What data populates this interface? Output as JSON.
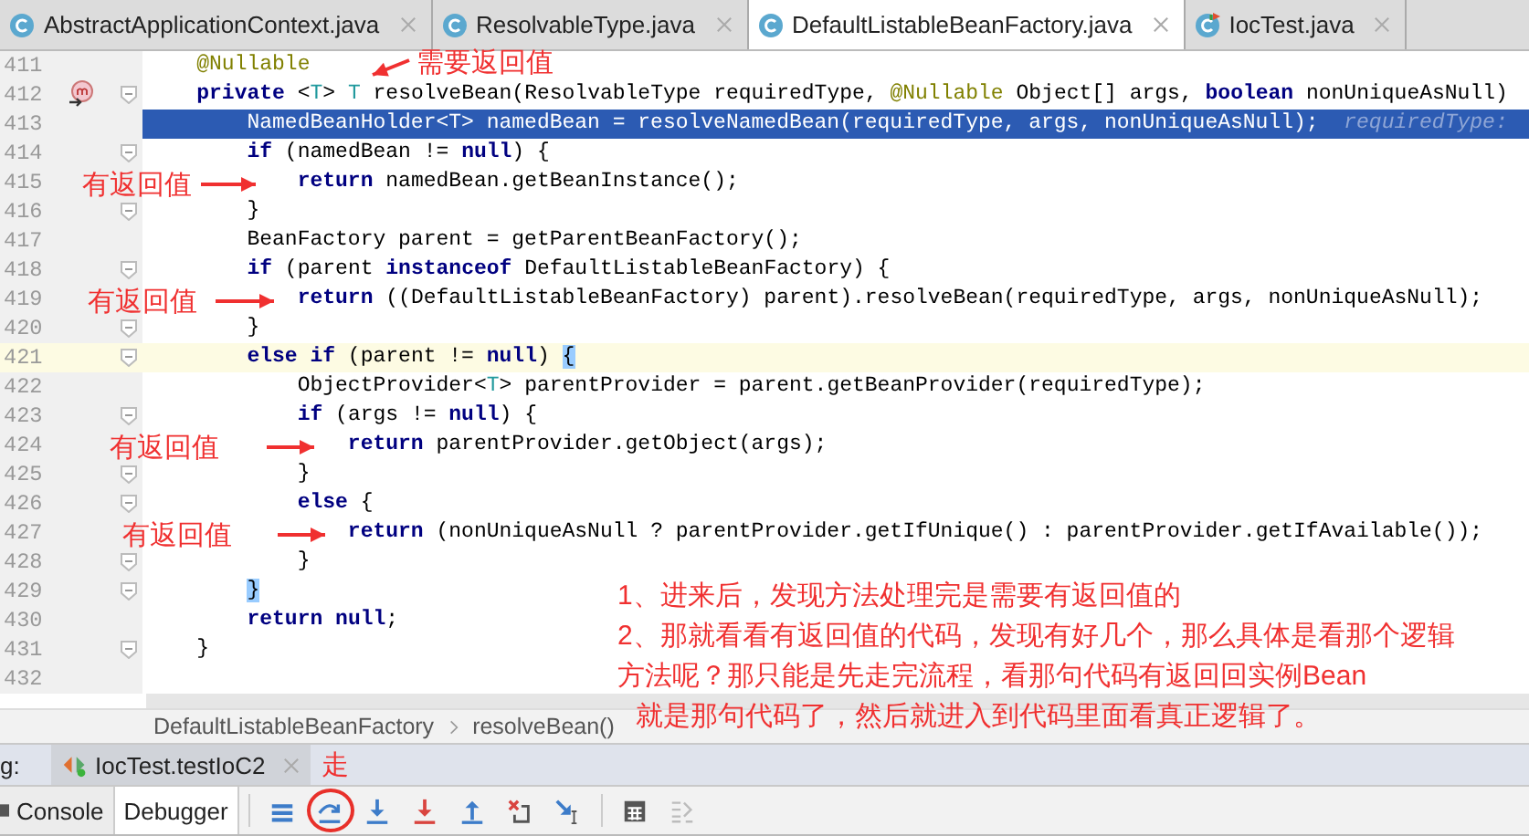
{
  "editor_tabs": [
    {
      "label": "AbstractApplicationContext.java",
      "selected": false,
      "kind": "class"
    },
    {
      "label": "ResolvableType.java",
      "selected": false,
      "kind": "class"
    },
    {
      "label": "DefaultListableBeanFactory.java",
      "selected": true,
      "kind": "class"
    },
    {
      "label": "IocTest.java",
      "selected": false,
      "kind": "test"
    }
  ],
  "code_lines": [
    {
      "number": "411",
      "fold": false,
      "execution": false,
      "caret": false,
      "method_marker": false,
      "segments": [
        {
          "text": "    @Nullable",
          "kind": "annotation"
        }
      ]
    },
    {
      "number": "412",
      "fold": true,
      "execution": false,
      "caret": false,
      "method_marker": true,
      "segments": [
        {
          "text": "    private",
          "kind": "keyword"
        },
        {
          "text": " <",
          "kind": "plain"
        },
        {
          "text": "T",
          "kind": "type_param"
        },
        {
          "text": "> ",
          "kind": "plain"
        },
        {
          "text": "T",
          "kind": "type_param"
        },
        {
          "text": " resolveBean(ResolvableType requiredType, ",
          "kind": "plain"
        },
        {
          "text": "@Nullable",
          "kind": "annotation"
        },
        {
          "text": " Object[] args, ",
          "kind": "plain"
        },
        {
          "text": "boolean",
          "kind": "keyword"
        },
        {
          "text": " nonUniqueAsNull)",
          "kind": "plain"
        }
      ]
    },
    {
      "number": "413",
      "fold": false,
      "execution": true,
      "caret": false,
      "method_marker": false,
      "segments": [
        {
          "text": "        NamedBeanHolder<T> namedBean = resolveNamedBean(requiredType, args, nonUniqueAsNull);  ",
          "kind": "plain"
        },
        {
          "text": "requiredType:",
          "kind": "hint"
        }
      ]
    },
    {
      "number": "414",
      "fold": true,
      "execution": false,
      "caret": false,
      "method_marker": false,
      "segments": [
        {
          "text": "        if",
          "kind": "keyword"
        },
        {
          "text": " (namedBean != ",
          "kind": "plain"
        },
        {
          "text": "null",
          "kind": "keyword"
        },
        {
          "text": ") {",
          "kind": "plain"
        }
      ]
    },
    {
      "number": "415",
      "fold": false,
      "execution": false,
      "caret": false,
      "method_marker": false,
      "segments": [
        {
          "text": "            return",
          "kind": "keyword"
        },
        {
          "text": " namedBean.getBeanInstance();",
          "kind": "plain"
        }
      ]
    },
    {
      "number": "416",
      "fold": true,
      "execution": false,
      "caret": false,
      "method_marker": false,
      "segments": [
        {
          "text": "        }",
          "kind": "plain"
        }
      ]
    },
    {
      "number": "417",
      "fold": false,
      "execution": false,
      "caret": false,
      "method_marker": false,
      "segments": [
        {
          "text": "        BeanFactory parent = getParentBeanFactory();",
          "kind": "plain"
        }
      ]
    },
    {
      "number": "418",
      "fold": true,
      "execution": false,
      "caret": false,
      "method_marker": false,
      "segments": [
        {
          "text": "        if",
          "kind": "keyword"
        },
        {
          "text": " (parent ",
          "kind": "plain"
        },
        {
          "text": "instanceof",
          "kind": "keyword"
        },
        {
          "text": " DefaultListableBeanFactory) {",
          "kind": "plain"
        }
      ]
    },
    {
      "number": "419",
      "fold": false,
      "execution": false,
      "caret": false,
      "method_marker": false,
      "segments": [
        {
          "text": "            return",
          "kind": "keyword"
        },
        {
          "text": " ((DefaultListableBeanFactory) parent).resolveBean(requiredType, args, nonUniqueAsNull);",
          "kind": "plain"
        }
      ]
    },
    {
      "number": "420",
      "fold": true,
      "execution": false,
      "caret": false,
      "method_marker": false,
      "segments": [
        {
          "text": "        }",
          "kind": "plain"
        }
      ]
    },
    {
      "number": "421",
      "fold": true,
      "execution": false,
      "caret": true,
      "method_marker": false,
      "segments": [
        {
          "text": "        else if",
          "kind": "keyword"
        },
        {
          "text": " (parent != ",
          "kind": "plain"
        },
        {
          "text": "null",
          "kind": "keyword"
        },
        {
          "text": ") ",
          "kind": "plain"
        },
        {
          "text": "{",
          "kind": "brace_match"
        }
      ]
    },
    {
      "number": "422",
      "fold": false,
      "execution": false,
      "caret": false,
      "method_marker": false,
      "segments": [
        {
          "text": "            ObjectProvider<",
          "kind": "plain"
        },
        {
          "text": "T",
          "kind": "type_param"
        },
        {
          "text": "> parentProvider = parent.getBeanProvider(requiredType);",
          "kind": "plain"
        }
      ]
    },
    {
      "number": "423",
      "fold": true,
      "execution": false,
      "caret": false,
      "method_marker": false,
      "segments": [
        {
          "text": "            if",
          "kind": "keyword"
        },
        {
          "text": " (args != ",
          "kind": "plain"
        },
        {
          "text": "null",
          "kind": "keyword"
        },
        {
          "text": ") {",
          "kind": "plain"
        }
      ]
    },
    {
      "number": "424",
      "fold": false,
      "execution": false,
      "caret": false,
      "method_marker": false,
      "segments": [
        {
          "text": "                return",
          "kind": "keyword"
        },
        {
          "text": " parentProvider.getObject(args);",
          "kind": "plain"
        }
      ]
    },
    {
      "number": "425",
      "fold": true,
      "execution": false,
      "caret": false,
      "method_marker": false,
      "segments": [
        {
          "text": "            }",
          "kind": "plain"
        }
      ]
    },
    {
      "number": "426",
      "fold": true,
      "execution": false,
      "caret": false,
      "method_marker": false,
      "segments": [
        {
          "text": "            else",
          "kind": "keyword"
        },
        {
          "text": " {",
          "kind": "plain"
        }
      ]
    },
    {
      "number": "427",
      "fold": false,
      "execution": false,
      "caret": false,
      "method_marker": false,
      "segments": [
        {
          "text": "                return",
          "kind": "keyword"
        },
        {
          "text": " (nonUniqueAsNull ? parentProvider.getIfUnique() : parentProvider.getIfAvailable());",
          "kind": "plain"
        }
      ]
    },
    {
      "number": "428",
      "fold": true,
      "execution": false,
      "caret": false,
      "method_marker": false,
      "segments": [
        {
          "text": "            }",
          "kind": "plain"
        }
      ]
    },
    {
      "number": "429",
      "fold": true,
      "execution": false,
      "caret": false,
      "method_marker": false,
      "segments": [
        {
          "text": "        }",
          "kind": "brace_match"
        }
      ]
    },
    {
      "number": "430",
      "fold": false,
      "execution": false,
      "caret": false,
      "method_marker": false,
      "segments": [
        {
          "text": "        return",
          "kind": "keyword"
        },
        {
          "text": " null",
          "kind": "keyword"
        },
        {
          "text": ";",
          "kind": "plain"
        }
      ]
    },
    {
      "number": "431",
      "fold": true,
      "execution": false,
      "caret": false,
      "method_marker": false,
      "segments": [
        {
          "text": "    }",
          "kind": "plain"
        }
      ]
    },
    {
      "number": "432",
      "fold": false,
      "execution": false,
      "caret": false,
      "method_marker": false
    }
  ],
  "annotation_labels": [
    "需要返回值",
    "有返回值",
    "有返回值",
    "有返回值",
    "有返回值"
  ],
  "note_lines": [
    "1、进来后，发现方法处理完是需要有返回值的",
    "2、那就看看有返回值的代码，发现有好几个，那么具体是看那个逻辑",
    "方法呢？那只能是先走完流程，看那句代码有返回回实例Bean",
    "就是那句代码了，然后就进入到代码里面看真正逻辑了。"
  ],
  "breadcrumb": [
    "DefaultListableBeanFactory",
    "resolveBean()"
  ],
  "debug_panel": {
    "label": "g:",
    "session_tab": "IocTest.testIoC2",
    "step_note": "走",
    "tabs": [
      {
        "label": "Console",
        "selected": false
      },
      {
        "label": "Debugger",
        "selected": true
      }
    ],
    "toolbar": [
      {
        "kind": "layout",
        "disabled": false,
        "circled": false
      },
      {
        "kind": "step-over",
        "disabled": false,
        "circled": true
      },
      {
        "kind": "step-into",
        "disabled": false,
        "circled": false
      },
      {
        "kind": "force-step-into",
        "disabled": false,
        "circled": false
      },
      {
        "kind": "step-out",
        "disabled": false,
        "circled": false
      },
      {
        "kind": "drop-frame",
        "disabled": false,
        "circled": false
      },
      {
        "kind": "run-to-cursor",
        "disabled": false,
        "circled": false
      },
      {
        "kind": "evaluate",
        "disabled": false,
        "circled": false
      },
      {
        "kind": "trace",
        "disabled": true,
        "circled": false
      }
    ]
  }
}
